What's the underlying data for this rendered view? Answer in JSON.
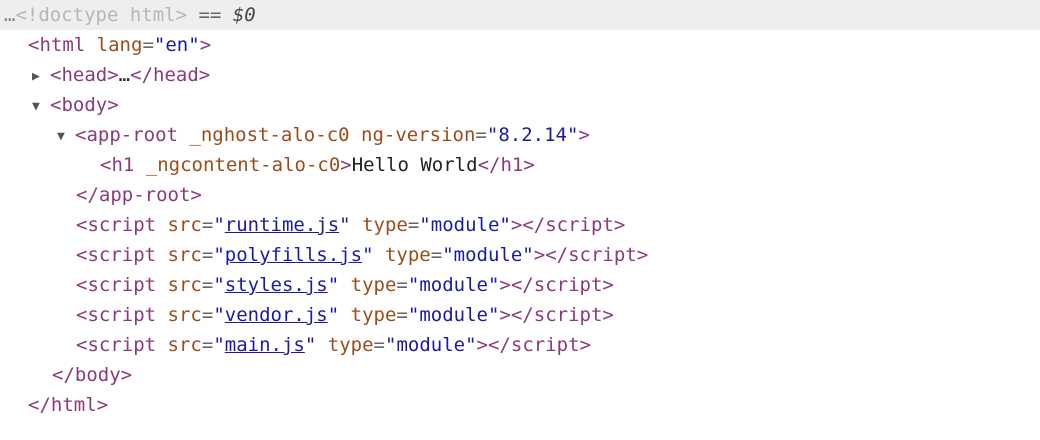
{
  "selected_line": {
    "dots": "…",
    "doctype": "<!doctype html>",
    "eq": " == ",
    "ref": "$0"
  },
  "symbols": {
    "lt": "<",
    "gt": ">",
    "close_lt": "</",
    "eq": "=",
    "quote": "\"",
    "ellipsis": "…",
    "expand_collapsed": "▶",
    "expand_open": "▼"
  },
  "html": {
    "tag": "html",
    "lang_attr": "lang",
    "lang_val": "en"
  },
  "head": {
    "tag": "head"
  },
  "body": {
    "tag": "body"
  },
  "app_root": {
    "tag": "app-root",
    "attr1": "_nghost-alo-c0",
    "attr2": "ng-version",
    "attr2_val": "8.2.14"
  },
  "h1": {
    "tag": "h1",
    "attr": "_ngcontent-alo-c0",
    "text": "Hello World"
  },
  "scripts": [
    {
      "tag": "script",
      "src_attr": "src",
      "src": "runtime.js",
      "type_attr": "type",
      "type": "module"
    },
    {
      "tag": "script",
      "src_attr": "src",
      "src": "polyfills.js",
      "type_attr": "type",
      "type": "module"
    },
    {
      "tag": "script",
      "src_attr": "src",
      "src": "styles.js",
      "type_attr": "type",
      "type": "module"
    },
    {
      "tag": "script",
      "src_attr": "src",
      "src": "vendor.js",
      "type_attr": "type",
      "type": "module"
    },
    {
      "tag": "script",
      "src_attr": "src",
      "src": "main.js",
      "type_attr": "type",
      "type": "module"
    }
  ]
}
